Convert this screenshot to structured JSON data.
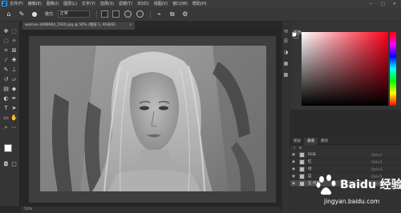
{
  "app": {
    "logo": "Ps"
  },
  "menubar": {
    "items": [
      "文件(F)",
      "编辑(E)",
      "图像(I)",
      "图层(L)",
      "文字(Y)",
      "选择(S)",
      "滤镜(T)",
      "3D(D)",
      "视图(V)",
      "窗口(W)",
      "帮助(H)"
    ],
    "window_controls": [
      "—",
      "□",
      "✕"
    ]
  },
  "options": {
    "mode_label": "模式:",
    "mode_value": "正常"
  },
  "document": {
    "tab_title": "woman-3096664_1920.jpg @ 50% (图层 1, RGB/8)",
    "close": "×"
  },
  "status": {
    "text": "50%"
  },
  "color_panel": {
    "tab1": "颜色",
    "fg": "#ffffff",
    "bg": "#000000",
    "hue_color": "#ff0019"
  },
  "layers_panel": {
    "tabs": [
      "图层",
      "通道",
      "路径"
    ],
    "active_tab": 0,
    "rows": [
      {
        "name": "RGB",
        "shortcut": "Ctrl+2",
        "selected": false
      },
      {
        "name": "红",
        "shortcut": "Ctrl+3",
        "selected": false
      },
      {
        "name": "绿",
        "shortcut": "Ctrl+4",
        "selected": false
      },
      {
        "name": "蓝",
        "shortcut": "Ctrl+5",
        "selected": false
      },
      {
        "name": "蓝 拷贝",
        "shortcut": "Ctrl+6",
        "selected": true
      }
    ]
  },
  "watermark": {
    "brand": "Baidu 经验",
    "url": "jingyan.baidu.com"
  }
}
